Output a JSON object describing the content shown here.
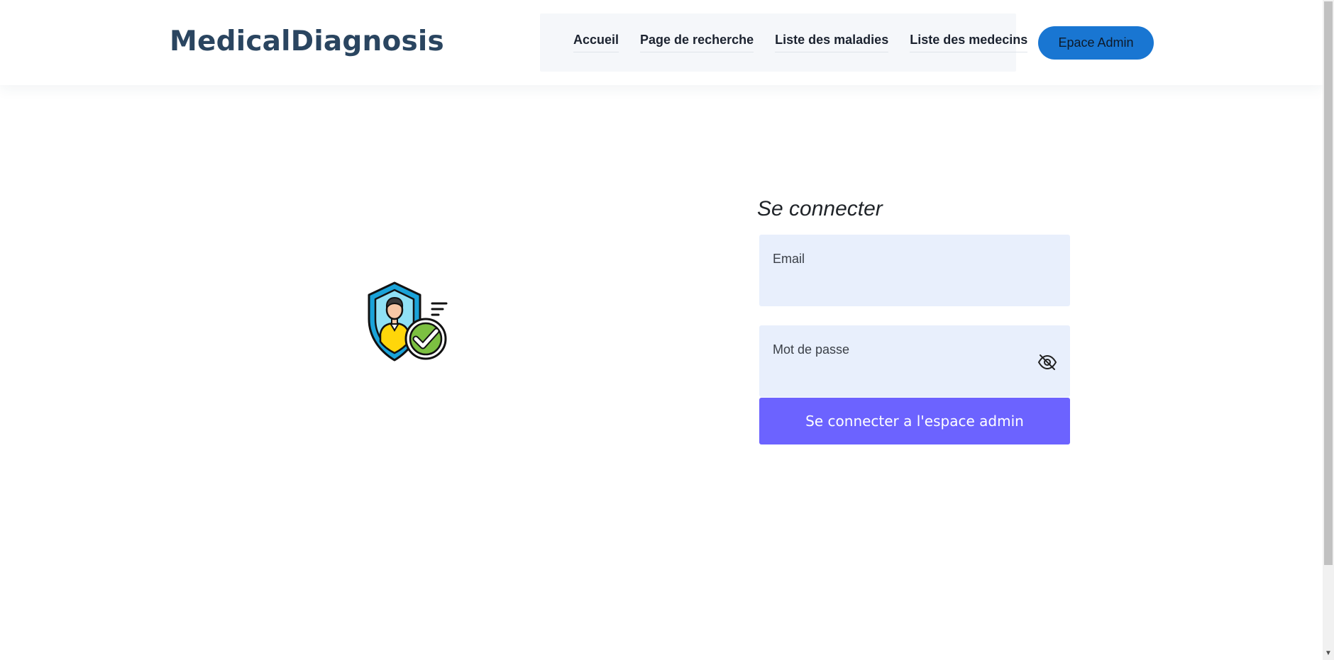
{
  "header": {
    "logo": "MedicalDiagnosis",
    "nav": [
      {
        "label": "Accueil"
      },
      {
        "label": "Page de recherche"
      },
      {
        "label": "Liste des maladies"
      },
      {
        "label": "Liste des medecins"
      }
    ],
    "admin_button": "Epace Admin"
  },
  "illustration": {
    "icon": "verified-user-shield-icon"
  },
  "login": {
    "title": "Se connecter",
    "email": {
      "label": "Email",
      "value": ""
    },
    "password": {
      "label": "Mot de passe",
      "value": "",
      "toggle_icon": "eye-slash-icon"
    },
    "submit": "Se connecter a l'espace admin"
  },
  "colors": {
    "logo": "#2a4560",
    "nav_bg": "#f5f7fa",
    "admin_button": "#1976d2",
    "field_bg": "#e8effc",
    "submit_button": "#6c63ff"
  }
}
